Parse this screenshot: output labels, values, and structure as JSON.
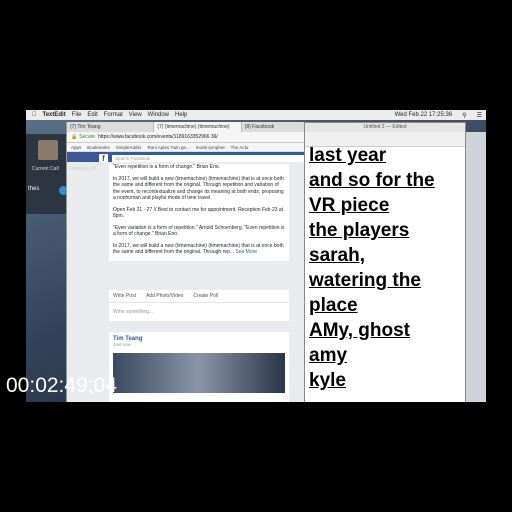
{
  "menubar": {
    "app_name": "TextEdit",
    "items": [
      "File",
      "Edit",
      "Format",
      "View",
      "Window",
      "Help"
    ],
    "clock": "Wed Feb 22  17:25:36"
  },
  "call": {
    "status": "Current Call",
    "name": "thes"
  },
  "browser": {
    "tabs": [
      "(7) Tim Teang",
      "(7) (timemachine) (timemachine)",
      "(8) Facebook"
    ],
    "secure_label": "Secure",
    "url": "https://www.facebook.com/events/1189163352966 36/",
    "bookmarks": [
      "Apps",
      "Bookmarks",
      "SimpleAdder",
      "Rani Aptes Twin ge...",
      "monk+prophet",
      "The Actu"
    ],
    "search_placeholder": "Search Facebook",
    "left_label": "February 23",
    "post_paragraphs": [
      "\"Even repetition is a form of change.\" Brian Eno.",
      "In 2017, we will build a new (timemachine) (timemachine) that is at once both the same and different from the original. Through repetition and variation of the event, to recontextualize and change its meaning at both ends, proposing a nonhuman and playful mode of time travel.",
      "Open Feb 21 - 27 // Best to contact me for appointment. Reception Feb 23 at 8pm.",
      "\"Even variation is a form of repetition.\" Arnold Schoenberg. \"Even repetition is a form of change.\" Brian Eno.",
      "In 2017, we will build a new (timemachine) (timemachine) that is at once both the same and different from the original. Through rep..."
    ],
    "see_more": "See More",
    "actions": [
      "Write Post",
      "Add Photo/Video",
      "Create Poll"
    ],
    "write_placeholder": "Write something...",
    "author": "Tim Teang",
    "author_sub": "Just now · ◌"
  },
  "textedit": {
    "title": "Untitled 2 — Edited",
    "lines": [
      "last year",
      "and so for the",
      "VR piece",
      "the players",
      "sarah,",
      "watering the",
      "place",
      "AMy, ghost",
      "amy",
      "kyle"
    ]
  },
  "timecode": "00:02:49;04"
}
